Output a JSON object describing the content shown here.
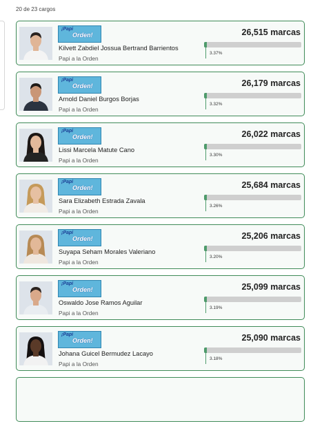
{
  "summary": {
    "count_text": "20 de 23 cargos"
  },
  "party": {
    "logo_line1": "¡Papi",
    "logo_line2": "Orden!"
  },
  "colors": {
    "accent": "#3e8a57",
    "bar_fill": "#4e9b6b",
    "bar_track": "#cfcfcf",
    "logo_bg": "#5fb6dc"
  },
  "candidates": [
    {
      "name": "Kilvett Zabdiel Jossua Bertrand Barrientos",
      "party": "Papi a la Orden",
      "votes": "26,515 marcas",
      "percent": "3.37%",
      "percent_value": 3.37,
      "photo": "man-white-shirt",
      "skin": "#e0b596",
      "hair": "#2a2320",
      "shirt": "#f4f4f4"
    },
    {
      "name": "Arnold Daniel Burgos Borjas",
      "party": "Papi a la Orden",
      "votes": "26,179 marcas",
      "percent": "3.32%",
      "percent_value": 3.32,
      "photo": "man-dark-suit",
      "skin": "#c99676",
      "hair": "#1e1a18",
      "shirt": "#2b3340"
    },
    {
      "name": "Lissi Marcela Matute Cano",
      "party": "Papi a la Orden",
      "votes": "26,022 marcas",
      "percent": "3.30%",
      "percent_value": 3.3,
      "photo": "woman-long-dark-hair",
      "skin": "#e3b99b",
      "hair": "#1d1715",
      "shirt": "#232323"
    },
    {
      "name": "Sara Elizabeth Estrada Zavala",
      "party": "Papi a la Orden",
      "votes": "25,684 marcas",
      "percent": "3.26%",
      "percent_value": 3.26,
      "photo": "woman-blonde-hair",
      "skin": "#e6c0a2",
      "hair": "#c59a5a",
      "shirt": "#f1ece6"
    },
    {
      "name": "Suyapa Seham Morales Valeriano",
      "party": "Papi a la Orden",
      "votes": "25,206 marcas",
      "percent": "3.20%",
      "percent_value": 3.2,
      "photo": "woman-light-brown-hair",
      "skin": "#e2b898",
      "hair": "#b78a55",
      "shirt": "#efe7df"
    },
    {
      "name": "Oswaldo Jose Ramos Aguilar",
      "party": "Papi a la Orden",
      "votes": "25,099 marcas",
      "percent": "3.19%",
      "percent_value": 3.19,
      "photo": "man-light-shirt",
      "skin": "#d9a98a",
      "hair": "#2c2420",
      "shirt": "#e9edf1"
    },
    {
      "name": "Johana Guicel Bermudez Lacayo",
      "party": "Papi a la Orden",
      "votes": "25,090 marcas",
      "percent": "3.18%",
      "percent_value": 3.18,
      "photo": "woman-curly-hair",
      "skin": "#5a3a28",
      "hair": "#141010",
      "shirt": "#f2f2f2"
    }
  ]
}
